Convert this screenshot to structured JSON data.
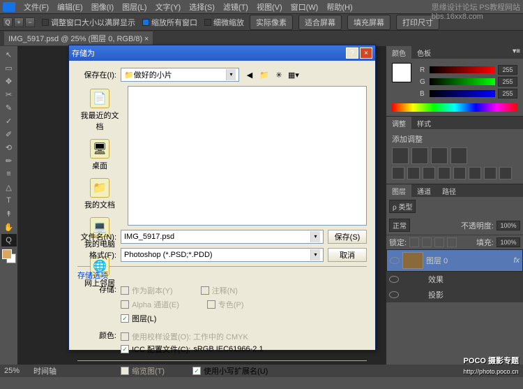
{
  "menubar": [
    "文件(F)",
    "编辑(E)",
    "图像(I)",
    "图层(L)",
    "文字(Y)",
    "选择(S)",
    "滤镜(T)",
    "视图(V)",
    "窗口(W)",
    "帮助(H)"
  ],
  "optbar": {
    "chk1": "调整窗口大小以满屏显示",
    "chk2": "缩放所有窗口",
    "chk3": "细微缩放",
    "btn1": "实际像素",
    "btn2": "适合屏幕",
    "btn3": "填充屏幕",
    "btn4": "打印尺寸"
  },
  "tab": {
    "title": "IMG_5917.psd @ 25% (图层 0, RGB/8)",
    "close": "×"
  },
  "tools": [
    "↖",
    "▭",
    "✥",
    "✂",
    "✎",
    "✓",
    "✐",
    "⟲",
    "✏",
    "≡",
    "△",
    "T",
    "↟",
    "✋",
    "Q"
  ],
  "color": {
    "tab1": "颜色",
    "tab2": "色板",
    "r": "R",
    "g": "G",
    "b": "B",
    "rv": "255",
    "gv": "255",
    "bv": "255"
  },
  "adj": {
    "tab1": "调整",
    "tab2": "样式",
    "title": "添加调整"
  },
  "layers": {
    "tab1": "图层",
    "tab2": "通道",
    "tab3": "路径",
    "kind": "ρ 类型",
    "normal": "正常",
    "opacity_lbl": "不透明度:",
    "opacity": "100%",
    "lock_lbl": "锁定:",
    "fill_lbl": "填充:",
    "fill": "100%",
    "layer0": "图层 0",
    "fx1": "效果",
    "fx2": "投影"
  },
  "dialog": {
    "title": "存储为",
    "savein_lbl": "保存在(I):",
    "folder": "做好的小片",
    "places": [
      "我最近的文档",
      "桌面",
      "我的文档",
      "我的电脑",
      "网上邻居"
    ],
    "place_icons": [
      "📄",
      "🖥",
      "📁",
      "💻",
      "🌐"
    ],
    "file_lbl": "文件名(N):",
    "file": "IMG_5917.psd",
    "fmt_lbl": "格式(F):",
    "fmt": "Photoshop (*.PSD;*.PDD)",
    "save_btn": "保存(S)",
    "cancel_btn": "取消",
    "store_opts": "存储选项",
    "store": "存储:",
    "as_copy": "作为副本(Y)",
    "annot": "注释(N)",
    "alpha": "Alpha 通道(E)",
    "spot": "专色(P)",
    "layers_chk": "图层(L)",
    "color_lbl": "颜色:",
    "proof": "使用校样设置(O): 工作中的 CMYK",
    "icc": "ICC 配置文件(C):",
    "icc_val": "sRGB IEC61966-2.1",
    "thumb": "缩览图(T)",
    "lowercase": "使用小写扩展名(U)"
  },
  "status": {
    "zoom": "25%",
    "timeline": "时间轴"
  },
  "wm": {
    "top1": "思缘设计论坛",
    "top2": "PS教程网站",
    "url": "bbs.16xx8.com",
    "bot": "POCO 摄影专题",
    "bot2": "http://photo.poco.cn"
  }
}
